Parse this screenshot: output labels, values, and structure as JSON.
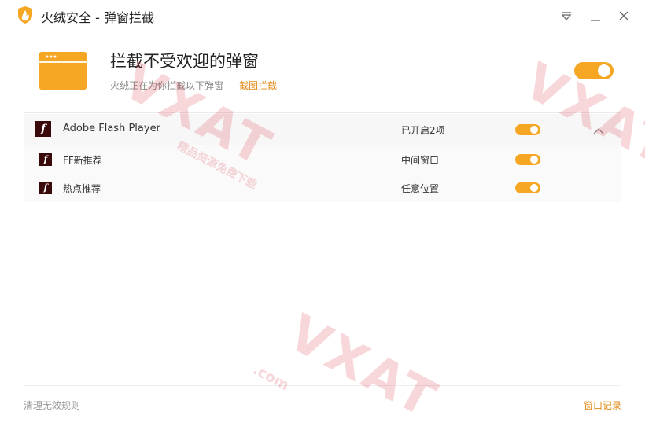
{
  "app": {
    "title": "火绒安全 - 弹窗拦截",
    "icons": {
      "logo": "huorong-shield-flame-icon",
      "menu": "dropdown-menu-icon",
      "minimize": "minimize-icon",
      "close": "close-icon"
    },
    "accent_color": "#f5a623"
  },
  "header": {
    "title": "拦截不受欢迎的弹窗",
    "description": "火绒正在为你拦截以下弹窗",
    "link_label": "截图拦截",
    "toggle_on": true,
    "icon": "popup-window-icon"
  },
  "rules": {
    "group": {
      "name": "Adobe Flash Player",
      "status": "已开启2项",
      "toggle_on": true,
      "expanded": true,
      "icon": "flash-icon"
    },
    "items": [
      {
        "name": "FF新推荐",
        "status": "中间窗口",
        "toggle_on": true,
        "icon": "flash-icon"
      },
      {
        "name": "热点推荐",
        "status": "任意位置",
        "toggle_on": true,
        "icon": "flash-icon"
      }
    ]
  },
  "footer": {
    "left_label": "清理无效规则",
    "right_label": "窗口记录"
  },
  "watermark": {
    "text": "VXAT",
    "sub": "精品资源免费下载",
    "domain": ".com"
  }
}
